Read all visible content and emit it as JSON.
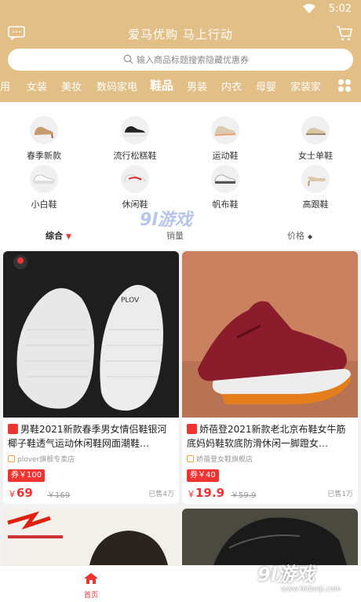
{
  "status": {
    "time": "5:02"
  },
  "header": {
    "title": "爱马优购 马上行动",
    "search_placeholder": "输入商品标题搜索隐藏优惠券"
  },
  "categories": [
    "用",
    "女装",
    "美妆",
    "数码家电",
    "鞋品",
    "男装",
    "内衣",
    "母婴",
    "家装家"
  ],
  "active_category": "鞋品",
  "subcategories": [
    "春季新款",
    "流行松糕鞋",
    "运动鞋",
    "女士单鞋",
    "小白鞋",
    "休闲鞋",
    "帆布鞋",
    "高跟鞋"
  ],
  "sort": {
    "general": "综合",
    "sales": "销量",
    "price": "价格"
  },
  "products": [
    {
      "title": "男鞋2021新款春季男女情侣鞋银河椰子鞋透气运动休闲鞋网面潮鞋…",
      "shop": "plover旗舰专卖店",
      "coupon": "券￥100",
      "yen": "￥",
      "price": "69",
      "original": "￥169",
      "sold": "已售4万"
    },
    {
      "title": "娇蓓登2021新款老北京布鞋女牛筋底妈妈鞋软底防滑休闲一脚蹬女…",
      "shop": "娇蓓登女鞋旗舰店",
      "coupon": "券￥40",
      "yen": "￥",
      "price": "19.9",
      "original": "￥59.9",
      "sold": "已售1万"
    }
  ],
  "tabbar": {
    "home": "首页"
  },
  "watermark": {
    "top": "9l游戏",
    "bottom": "9l游戏",
    "url": "www.9ldanji.com"
  },
  "colors": {
    "header": "#e2bf86",
    "accent": "#e33333"
  }
}
